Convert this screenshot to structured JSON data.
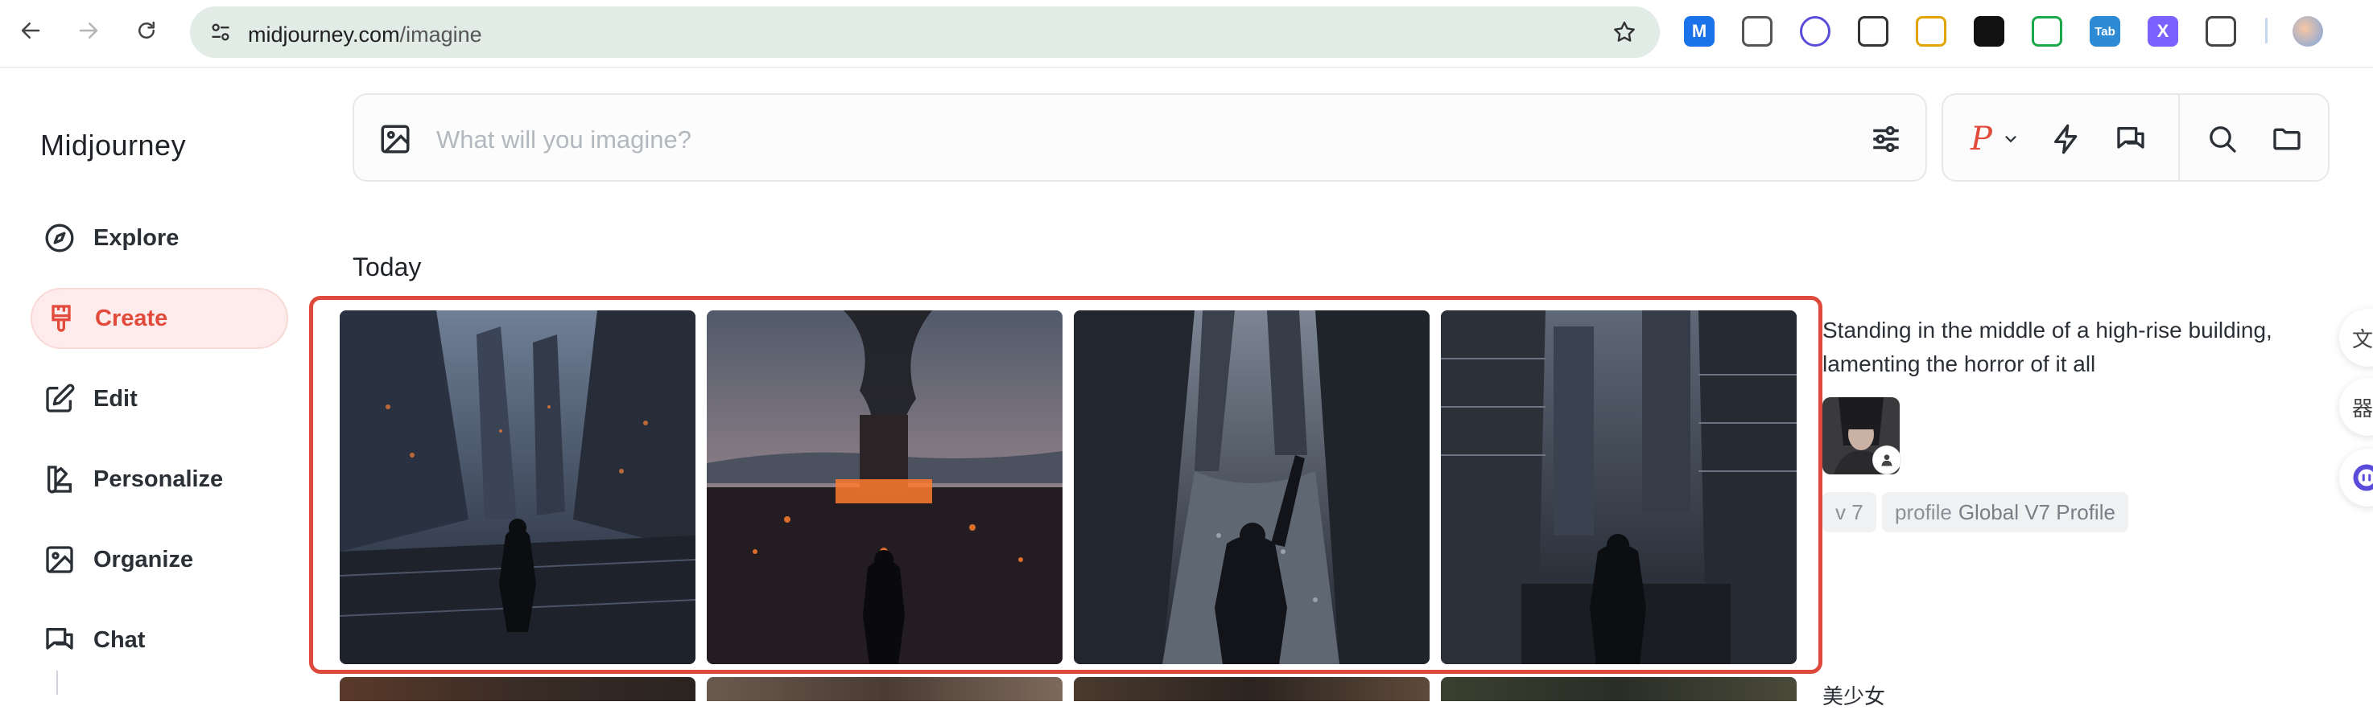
{
  "browser": {
    "url_domain": "midjourney.com",
    "url_path": "/imagine",
    "extensions": [
      {
        "icon": "m-extension-icon",
        "label": "M",
        "color": "#1a73e8"
      },
      {
        "icon": "copy-extension-icon",
        "label": "",
        "color": "#555555"
      },
      {
        "icon": "eyes-extension-icon",
        "label": "",
        "color": "#5a4cdb"
      },
      {
        "icon": "qr-extension-icon",
        "label": "",
        "color": "#333333"
      },
      {
        "icon": "fox-extension-icon",
        "label": "",
        "color": "#e2a400"
      },
      {
        "icon": "dots-extension-icon",
        "label": "",
        "color": "#111111"
      },
      {
        "icon": "shield-extension-icon",
        "label": "",
        "color": "#1aa84a"
      },
      {
        "icon": "tab-extension-icon",
        "label": "Tab",
        "color": "#2d8bd6"
      },
      {
        "icon": "x-extension-icon",
        "label": "X",
        "color": "#7b61ff"
      },
      {
        "icon": "puzzle-extension-icon",
        "label": "",
        "color": "#444444"
      }
    ]
  },
  "sidebar": {
    "brand": "Midjourney",
    "items": [
      {
        "label": "Explore",
        "icon": "compass-icon",
        "active": false
      },
      {
        "label": "Create",
        "icon": "brush-icon",
        "active": true
      },
      {
        "label": "Edit",
        "icon": "edit-icon",
        "active": false
      },
      {
        "label": "Personalize",
        "icon": "palette-icon",
        "active": false
      },
      {
        "label": "Organize",
        "icon": "image-icon",
        "active": false
      },
      {
        "label": "Chat",
        "icon": "chat-icon",
        "active": false
      }
    ]
  },
  "prompt_bar": {
    "placeholder": "What will you imagine?"
  },
  "toolbar": {
    "personalize_glyph": "P"
  },
  "feed": {
    "section_heading": "Today",
    "job": {
      "prompt": "Standing in the middle of a high-rise building, lamenting the horror of it all",
      "chip_version": "v 7",
      "chip_profile_prefix": "profile",
      "chip_profile_name": "Global V7 Profile"
    },
    "next_prompt": "美少女"
  },
  "float_buttons": [
    "文",
    "器",
    ""
  ],
  "colors": {
    "accent": "#e24a3b",
    "highlight_border": "#dd4a3c",
    "omnibox_bg": "#e1ece6"
  }
}
